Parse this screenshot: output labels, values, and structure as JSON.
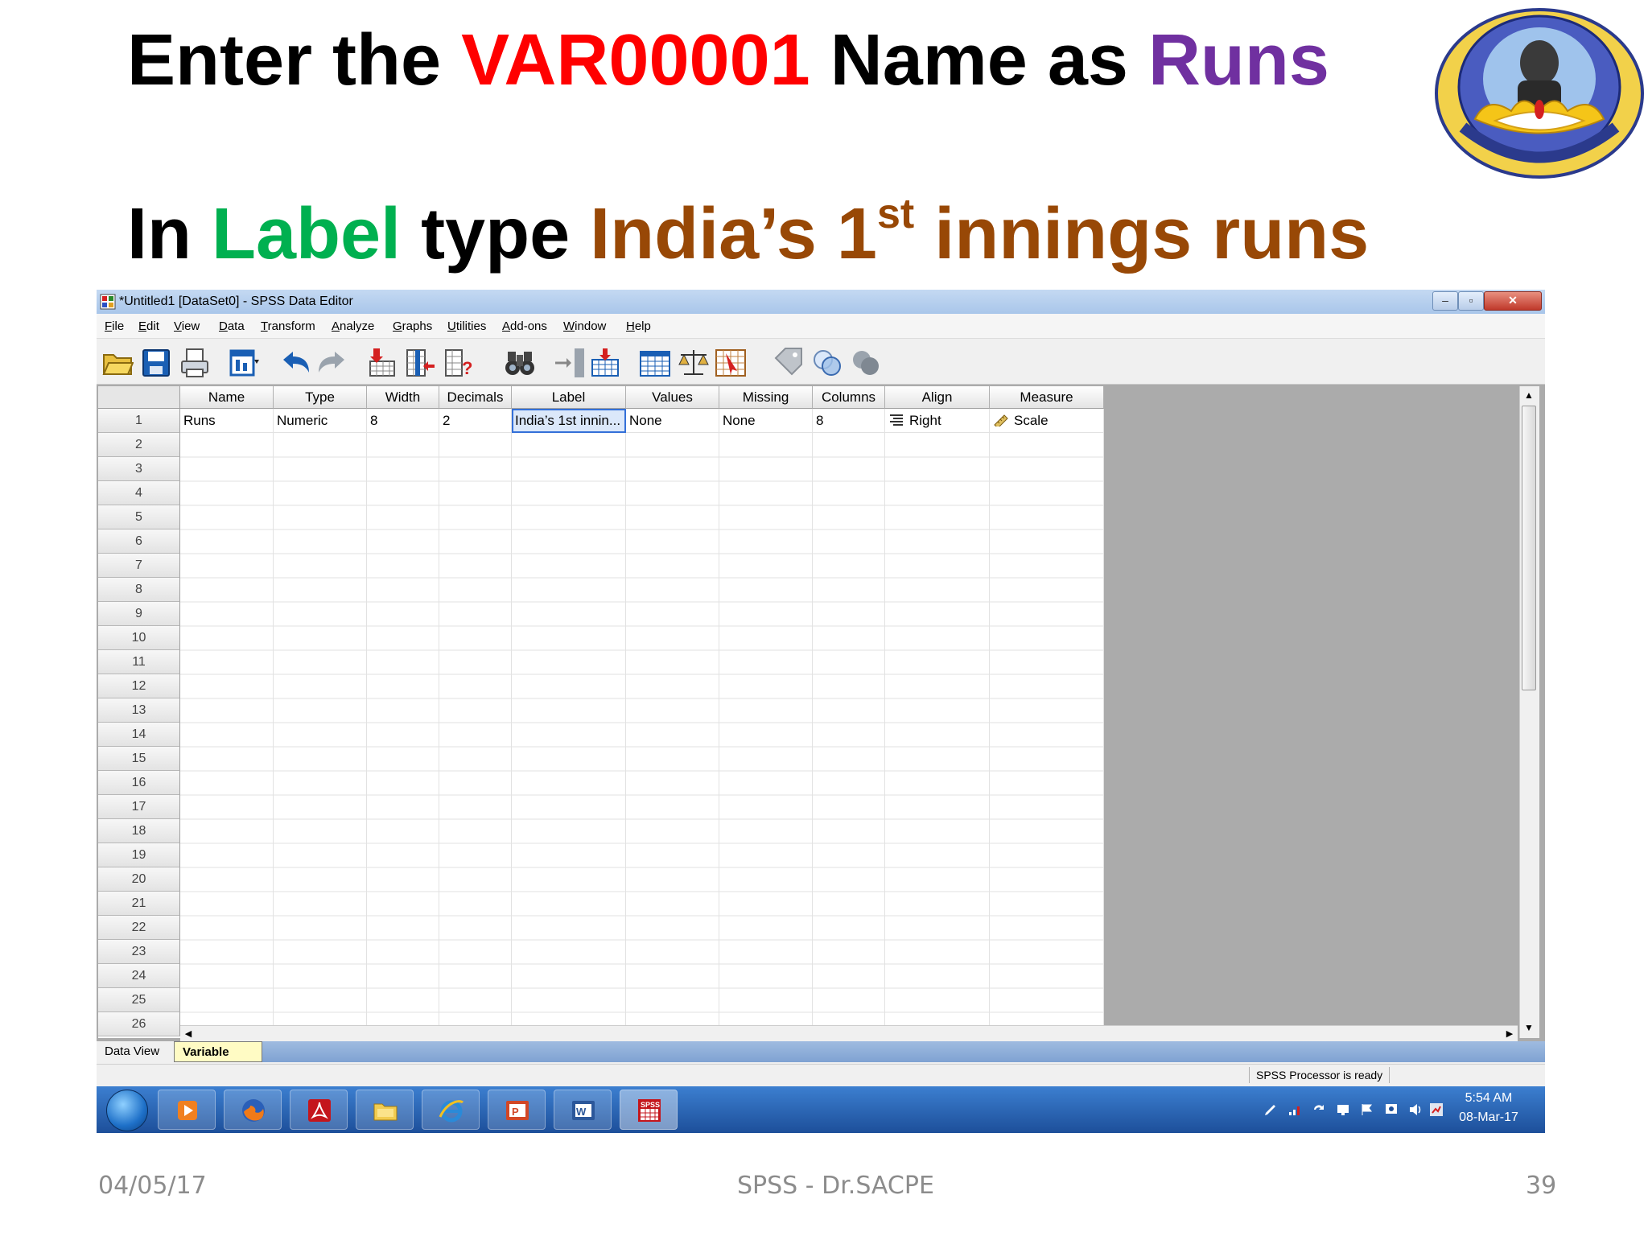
{
  "slide": {
    "title1": {
      "p1": "Enter the ",
      "p2": "VAR00001",
      "p3": " Name as ",
      "p4": "Runs"
    },
    "title2": {
      "p1": "In ",
      "p2": "Label",
      "p3": " type ",
      "p4": "India’s 1",
      "sup": "st",
      "p5": " innings runs"
    },
    "colors": {
      "red": "#ff0000",
      "purple": "#7030a0",
      "green": "#00b050",
      "brown": "#984806"
    },
    "footer": {
      "date": "04/05/17",
      "title": "SPSS - Dr.SACPE",
      "page": "39"
    },
    "logo_icon": "university-seal-icon"
  },
  "window": {
    "title": "*Untitled1 [DataSet0] - SPSS Data Editor",
    "controls": {
      "minimize": "–",
      "maximize": "▫",
      "close": "✕"
    }
  },
  "menu": [
    "File",
    "Edit",
    "View",
    "Data",
    "Transform",
    "Analyze",
    "Graphs",
    "Utilities",
    "Add-ons",
    "Window",
    "Help"
  ],
  "toolbar_icons": [
    "open-folder-icon",
    "save-icon",
    "print-icon",
    "dialog-recall-icon",
    "undo-icon",
    "redo-icon",
    "goto-case-icon",
    "goto-variable-icon",
    "variables-info-icon",
    "find-icon",
    "insert-cases-icon",
    "insert-variable-icon",
    "split-file-icon",
    "weight-cases-icon",
    "select-cases-icon",
    "value-labels-icon",
    "use-sets-icon",
    "show-all-variables-icon"
  ],
  "grid": {
    "columns": [
      "Name",
      "Type",
      "Width",
      "Decimals",
      "Label",
      "Values",
      "Missing",
      "Columns",
      "Align",
      "Measure"
    ],
    "row_numbers": [
      "1",
      "2",
      "3",
      "4",
      "5",
      "6",
      "7",
      "8",
      "9",
      "10",
      "11",
      "12",
      "13",
      "14",
      "15",
      "16",
      "17",
      "18",
      "19",
      "20",
      "21",
      "22",
      "23",
      "24",
      "25",
      "26"
    ],
    "row1": {
      "name": "Runs",
      "type": "Numeric",
      "width": "8",
      "decimals": "2",
      "label": "India’s 1st innin...",
      "values": "None",
      "missing": "None",
      "columns": "8",
      "align": "Right",
      "measure": "Scale"
    }
  },
  "scroll": {
    "up": "▲",
    "down": "▼",
    "left": "◀",
    "right": "▶"
  },
  "tabs": {
    "data_view": "Data View",
    "variable_view": "Variable View"
  },
  "status": {
    "text": "SPSS  Processor is ready"
  },
  "taskbar": {
    "apps": [
      "media-player-icon",
      "firefox-icon",
      "acrobat-icon",
      "file-explorer-icon",
      "internet-explorer-icon",
      "powerpoint-icon",
      "word-icon",
      "spss-icon"
    ],
    "spss_label": "SPSS",
    "clock_time": "5:54 AM",
    "clock_date": "08-Mar-17"
  }
}
